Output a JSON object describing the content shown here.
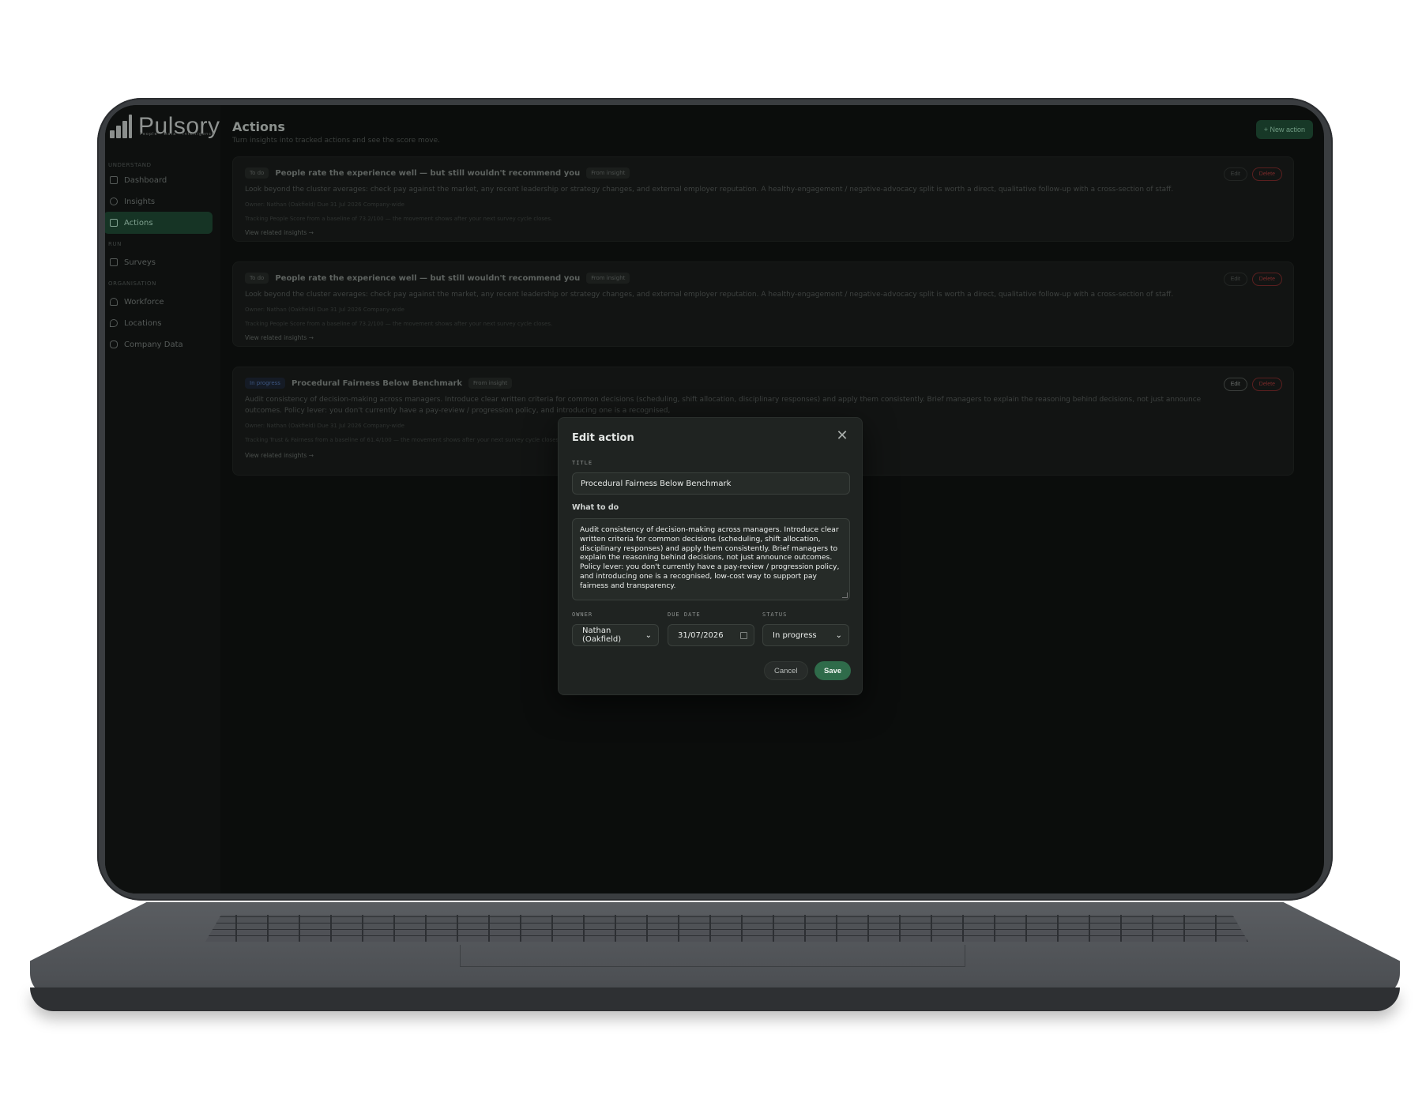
{
  "app": {
    "name": "Pulsory",
    "tagline": "People · Data · Intelligence"
  },
  "sidebar": {
    "sections": [
      {
        "label": "UNDERSTAND"
      },
      {
        "label": "RUN"
      },
      {
        "label": "ORGANISATION"
      }
    ],
    "items": [
      {
        "label": "Dashboard",
        "icon": "dashboard-icon"
      },
      {
        "label": "Insights",
        "icon": "lightbulb-icon"
      },
      {
        "label": "Actions",
        "icon": "checklist-icon",
        "active": true
      },
      {
        "label": "Surveys",
        "icon": "clipboard-icon"
      },
      {
        "label": "Workforce",
        "icon": "users-icon"
      },
      {
        "label": "Locations",
        "icon": "location-pin-icon"
      },
      {
        "label": "Company Data",
        "icon": "database-icon"
      }
    ]
  },
  "page": {
    "title": "Actions",
    "subtitle": "Turn insights into tracked actions and see the score move.",
    "new_button": "+ New action"
  },
  "cards": [
    {
      "status": "To do",
      "title": "People rate the experience well — but still wouldn't recommend you",
      "tag": "From insight",
      "desc": "Look beyond the cluster averages: check pay against the market, any recent leadership or strategy changes, and external employer reputation. A healthy-engagement / negative-advocacy split is worth a direct, qualitative follow-up with a cross-section of staff.",
      "meta": "Owner: Nathan (Oakfield)    Due 31 Jul 2026    Company-wide",
      "tracking": "Tracking People Score from a baseline of 73.2/100 — the movement shows after your next survey cycle closes.",
      "link": "View related insights →",
      "edit": "Edit",
      "delete": "Delete"
    },
    {
      "status": "To do",
      "title": "People rate the experience well — but still wouldn't recommend you",
      "tag": "From insight",
      "desc": "Look beyond the cluster averages: check pay against the market, any recent leadership or strategy changes, and external employer reputation. A healthy-engagement / negative-advocacy split is worth a direct, qualitative follow-up with a cross-section of staff.",
      "meta": "Owner: Nathan (Oakfield)    Due 31 Jul 2026    Company-wide",
      "tracking": "Tracking People Score from a baseline of 73.2/100 — the movement shows after your next survey cycle closes.",
      "link": "View related insights →",
      "edit": "Edit",
      "delete": "Delete"
    },
    {
      "status": "In progress",
      "title": "Procedural Fairness Below Benchmark",
      "tag": "From insight",
      "desc": "Audit consistency of decision-making across managers. Introduce clear written criteria for common decisions (scheduling, shift allocation, disciplinary responses) and apply them consistently. Brief managers to explain the reasoning behind decisions, not just announce outcomes. Policy lever: you don't currently have a pay-review / progression policy, and introducing one is a recognised,",
      "meta": "Owner: Nathan (Oakfield)    Due 31 Jul 2026    Company-wide",
      "tracking": "Tracking Trust & Fairness from a baseline of 61.4/100 — the movement shows after your next survey cycle closes.",
      "link": "View related insights →",
      "edit": "Edit",
      "delete": "Delete"
    }
  ],
  "modal": {
    "title": "Edit action",
    "title_label": "TITLE",
    "title_value": "Procedural Fairness Below Benchmark",
    "what_label": "What to do",
    "what_value": "Audit consistency of decision-making across managers. Introduce clear written criteria for common decisions (scheduling, shift allocation, disciplinary responses) and apply them consistently. Brief managers to explain the reasoning behind decisions, not just announce outcomes. Policy lever: you don't currently have a pay-review / progression policy, and introducing one is a recognised, low-cost way to support pay fairness and transparency.",
    "owner_label": "OWNER",
    "owner_value": "Nathan (Oakfield)",
    "due_label": "DUE DATE",
    "due_value": "31/07/2026",
    "status_label": "STATUS",
    "status_value": "In progress",
    "cancel": "Cancel",
    "save": "Save"
  },
  "colors": {
    "accent": "#2f6b4a",
    "danger": "#7a2a2a",
    "background": "#0b0d0c"
  }
}
